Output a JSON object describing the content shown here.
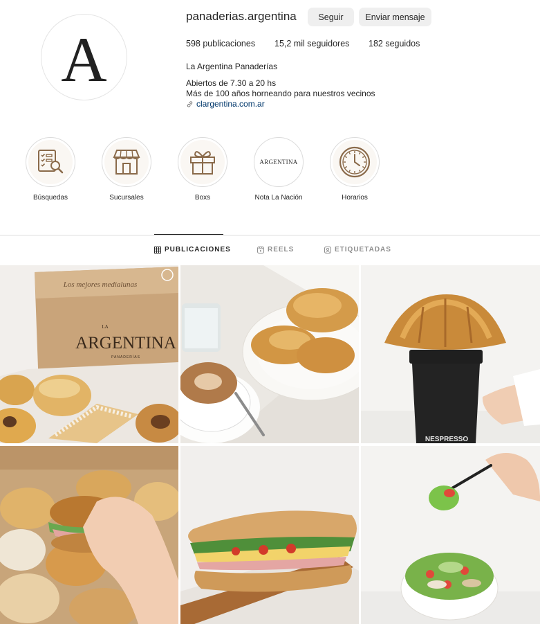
{
  "profile": {
    "avatar_letter": "A",
    "username": "panaderias.argentina",
    "follow_label": "Seguir",
    "message_label": "Enviar mensaje",
    "stats": {
      "posts": "598 publicaciones",
      "followers": "15,2 mil seguidores",
      "following": "182 seguidos"
    },
    "full_name": "La Argentina Panaderías",
    "bio_line1": "Abiertos de 7.30 a 20 hs",
    "bio_line2": "Más de 100 años horneando para nuestros vecinos",
    "website": "clargentina.com.ar"
  },
  "highlights": [
    {
      "label": "Búsquedas",
      "icon": "search-list-icon"
    },
    {
      "label": "Sucursales",
      "icon": "storefront-icon"
    },
    {
      "label": "Boxs",
      "icon": "gift-box-icon"
    },
    {
      "label": "Nota La Nación",
      "icon": "argentina-logo",
      "logo_text": "ARGENTINA"
    },
    {
      "label": "Horarios",
      "icon": "clock-icon"
    }
  ],
  "tabs": [
    {
      "label": "PUBLICACIONES",
      "icon": "grid-icon",
      "active": true
    },
    {
      "label": "REELS",
      "icon": "reels-icon",
      "active": false
    },
    {
      "label": "ETIQUETADAS",
      "icon": "tagged-icon",
      "active": false
    }
  ],
  "posts": {
    "post1_box_text": "ARGENTINA",
    "post1_box_small": "LA",
    "post1_box_sub": "PANADERÍAS",
    "post1_box_top": "Los mejores medialunas",
    "post3_cup_brand": "NESPRESSO"
  },
  "colors": {
    "accent_brown": "#8a6a4a",
    "link_blue": "#00376b",
    "button_bg": "#efefef"
  }
}
